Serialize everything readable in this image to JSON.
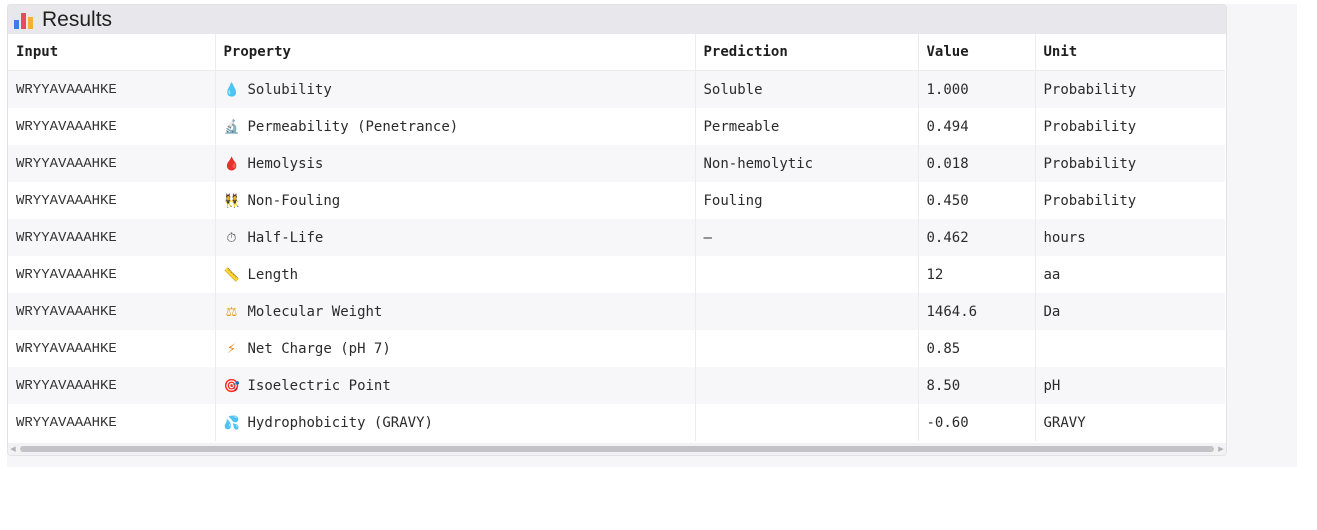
{
  "header": {
    "title": "Results"
  },
  "table": {
    "columns": [
      "Input",
      "Property",
      "Prediction",
      "Value",
      "Unit"
    ],
    "rows": [
      {
        "input": "WRYYAVAAAHKE",
        "icon": "droplet-icon",
        "icon_glyph": "💧",
        "icon_color": "#3f8ee8",
        "property": "Solubility",
        "prediction": "Soluble",
        "value": "1.000",
        "unit": "Probability"
      },
      {
        "input": "WRYYAVAAAHKE",
        "icon": "microscope-icon",
        "icon_glyph": "🔬",
        "icon_color": "#6b6b6b",
        "property": "Permeability (Penetrance)",
        "prediction": "Permeable",
        "value": "0.494",
        "unit": "Probability"
      },
      {
        "input": "WRYYAVAAAHKE",
        "icon": "blood-drop-icon",
        "icon_glyph": "🩸",
        "icon_color": "#e0243f",
        "property": "Hemolysis",
        "prediction": "Non-hemolytic",
        "value": "0.018",
        "unit": "Probability"
      },
      {
        "input": "WRYYAVAAAHKE",
        "icon": "people-icon",
        "icon_glyph": "👯",
        "icon_color": "#d08a2a",
        "property": "Non-Fouling",
        "prediction": "Fouling",
        "value": "0.450",
        "unit": "Probability"
      },
      {
        "input": "WRYYAVAAAHKE",
        "icon": "stopwatch-icon",
        "icon_glyph": "⏱",
        "icon_color": "#555555",
        "property": "Half-Life",
        "prediction": "—",
        "value": "0.462",
        "unit": "hours"
      },
      {
        "input": "WRYYAVAAAHKE",
        "icon": "ruler-icon",
        "icon_glyph": "📏",
        "icon_color": "#9a9aa2",
        "property": "Length",
        "prediction": "",
        "value": "12",
        "unit": "aa"
      },
      {
        "input": "WRYYAVAAAHKE",
        "icon": "scale-icon",
        "icon_glyph": "⚖",
        "icon_color": "#e0a12a",
        "property": "Molecular Weight",
        "prediction": "",
        "value": "1464.6",
        "unit": "Da"
      },
      {
        "input": "WRYYAVAAAHKE",
        "icon": "lightning-icon",
        "icon_glyph": "⚡",
        "icon_color": "#f08a1a",
        "property": "Net Charge (pH 7)",
        "prediction": "",
        "value": "0.85",
        "unit": ""
      },
      {
        "input": "WRYYAVAAAHKE",
        "icon": "target-icon",
        "icon_glyph": "🎯",
        "icon_color": "#d8344c",
        "property": "Isoelectric Point",
        "prediction": "",
        "value": "8.50",
        "unit": "pH"
      },
      {
        "input": "WRYYAVAAAHKE",
        "icon": "water-splash-icon",
        "icon_glyph": "💦",
        "icon_color": "#3aa0e8",
        "property": "Hydrophobicity (GRAVY)",
        "prediction": "",
        "value": "-0.60",
        "unit": "GRAVY"
      }
    ]
  },
  "scrollbar": {
    "left_arrow": "◀",
    "right_arrow": "▶"
  }
}
